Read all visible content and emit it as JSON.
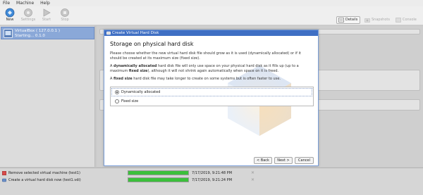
{
  "menu": [
    "File",
    "Machine",
    "Help"
  ],
  "toolbar": {
    "buttons": [
      {
        "label": "New",
        "icon": "new-machine-icon"
      },
      {
        "label": "Settings",
        "icon": "gear-icon"
      },
      {
        "label": "Start",
        "icon": "start-arrow-icon"
      },
      {
        "label": "Stop",
        "icon": "stop-icon"
      }
    ],
    "details_label": "Details",
    "snapshots_label": "Snapshots",
    "console_label": "Console"
  },
  "vm_list": {
    "items": [
      {
        "name": "VirtualBox ( 127.0.0.1 )",
        "state": "Starting... 0.1.0"
      }
    ]
  },
  "dialog": {
    "title": "Create Virtual Hard Disk",
    "heading": "Storage on physical hard disk",
    "para1": "Please choose whether the new virtual hard disk file should grow as it is used (dynamically allocated) or if it should be created at its maximum size (fixed size).",
    "para2_bold": "dynamically allocated",
    "para2_pre": "A ",
    "para2_mid": " hard disk file will only use space on your physical hard disk as it fills up (up to a maximum ",
    "para2_bold2": "fixed size",
    "para2_post": "), although it will not shrink again automatically when space on it is freed.",
    "para3_pre": "A ",
    "para3_bold": "fixed size",
    "para3_post": " hard disk file may take longer to create on some systems but is often faster to use.",
    "options": [
      {
        "label": "Dynamically allocated",
        "selected": true
      },
      {
        "label": "Fixed size",
        "selected": false
      }
    ],
    "back_label": "< Back",
    "next_label": "Next >",
    "cancel_label": "Cancel"
  },
  "progress": {
    "rows": [
      {
        "text": "Remove selected virtual machine (test1)",
        "percent": 100,
        "time": "7/17/2019, 9:21:48 PM"
      },
      {
        "text": "Create a virtual hard disk now (test1.vdi)",
        "percent": 100,
        "time": "7/17/2019, 9:21:24 PM"
      }
    ],
    "close_glyph": "✕"
  },
  "colors": {
    "accent": "#3f6fc4",
    "selection": "#8aa8d8",
    "progress_fill": "#3bbf3b"
  }
}
